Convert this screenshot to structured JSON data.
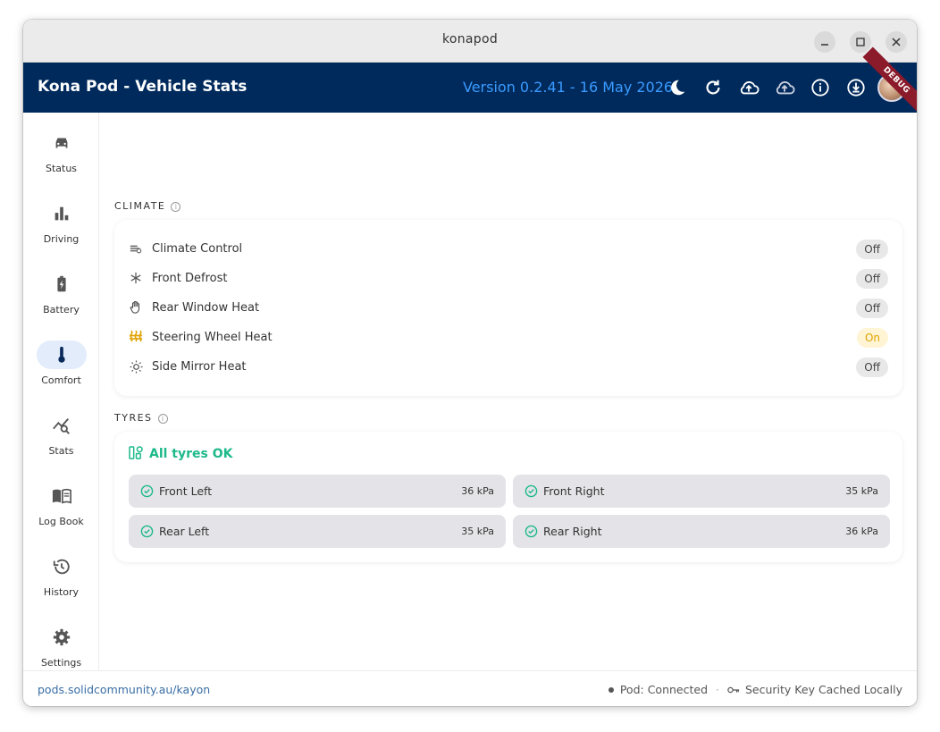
{
  "window": {
    "title": "konapod"
  },
  "appbar": {
    "title": "Kona Pod - Vehicle Stats",
    "version": "Version 0.2.41 - 16 May 2026",
    "debug_label": "DEBUG",
    "icons": [
      "dark-mode-icon",
      "refresh-icon",
      "cloud-upload-icon",
      "cloud-sync-icon",
      "info-icon",
      "download-icon"
    ]
  },
  "sidebar": {
    "items": [
      {
        "label": "Status",
        "icon": "car-icon"
      },
      {
        "label": "Driving",
        "icon": "bar-chart-icon"
      },
      {
        "label": "Battery",
        "icon": "battery-icon"
      },
      {
        "label": "Comfort",
        "icon": "thermometer-icon",
        "active": true
      },
      {
        "label": "Stats",
        "icon": "analytics-icon"
      },
      {
        "label": "Log Book",
        "icon": "book-icon"
      },
      {
        "label": "History",
        "icon": "history-icon"
      },
      {
        "label": "Settings",
        "icon": "gear-icon"
      }
    ]
  },
  "climate": {
    "heading": "CLIMATE",
    "rows": [
      {
        "label": "Climate Control",
        "state": "Off",
        "icon": "fan-icon"
      },
      {
        "label": "Front Defrost",
        "state": "Off",
        "icon": "snowflake-icon"
      },
      {
        "label": "Rear Window Heat",
        "state": "Off",
        "icon": "hand-icon"
      },
      {
        "label": "Steering Wheel Heat",
        "state": "On",
        "icon": "heat-icon"
      },
      {
        "label": "Side Mirror Heat",
        "state": "Off",
        "icon": "sun-icon"
      }
    ]
  },
  "tyres": {
    "heading": "TYRES",
    "summary": "All tyres OK",
    "items": [
      {
        "name": "Front Left",
        "pressure": "36 kPa"
      },
      {
        "name": "Front Right",
        "pressure": "35 kPa"
      },
      {
        "name": "Rear Left",
        "pressure": "35 kPa"
      },
      {
        "name": "Rear Right",
        "pressure": "36 kPa"
      }
    ]
  },
  "footer": {
    "webid": "pods.solidcommunity.au/kayon",
    "pod_status": "Pod: Connected",
    "separator": "·",
    "key_status": "Security Key Cached Locally"
  },
  "colors": {
    "appbar": "#002a5c",
    "version": "#3a9bff",
    "ok": "#1db98a",
    "on_badge": "#e0a200",
    "active_nav": "#e3ecfb"
  }
}
